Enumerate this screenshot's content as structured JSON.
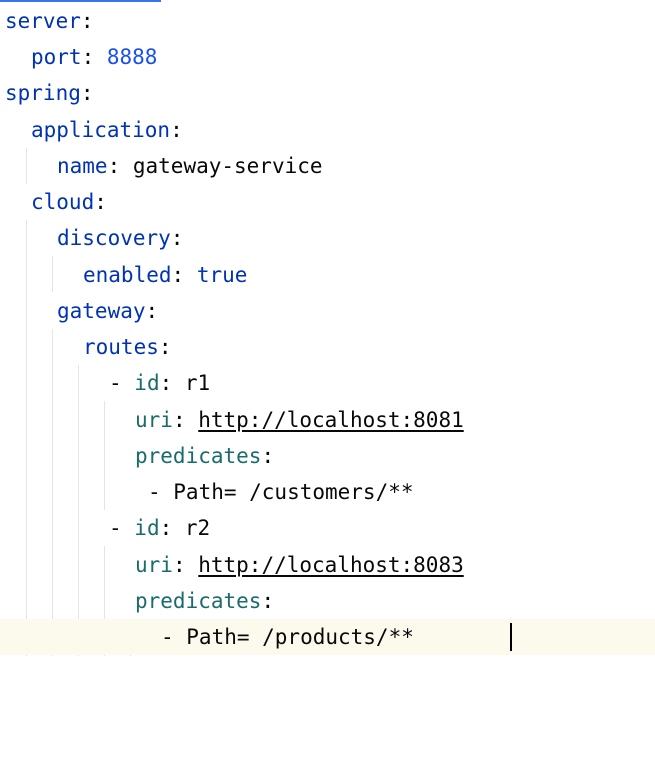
{
  "editor": {
    "lines": [
      {
        "key": "server",
        "sep": ":"
      },
      {
        "key": "port",
        "sep": ": ",
        "value": "8888"
      },
      {
        "key": "spring",
        "sep": ":"
      },
      {
        "key": "application",
        "sep": ":"
      },
      {
        "key": "name",
        "sep": ": ",
        "value": "gateway-service"
      },
      {
        "key": "cloud",
        "sep": ":"
      },
      {
        "key": "discovery",
        "sep": ":"
      },
      {
        "key": "enabled",
        "sep": ": ",
        "value": "true"
      },
      {
        "key": "gateway",
        "sep": ":"
      },
      {
        "key": "routes",
        "sep": ":"
      },
      {
        "dash": "- ",
        "key": "id",
        "sep": ": ",
        "value": "r1"
      },
      {
        "key": "uri",
        "sep": ": ",
        "value": "http://localhost:8081"
      },
      {
        "key": "predicates",
        "sep": ":"
      },
      {
        "value": "- Path= /customers/**"
      },
      {
        "dash": "- ",
        "key": "id",
        "sep": ": ",
        "value": "r2"
      },
      {
        "key": "uri",
        "sep": ": ",
        "value": "http://localhost:8083"
      },
      {
        "key": "predicates",
        "sep": ":"
      },
      {
        "value": "- Path= /products/**"
      }
    ]
  },
  "colors": {
    "key": "#0033b3",
    "nested_key": "#1a6b6b",
    "number": "#1750eb",
    "current_line": "#fcfaed",
    "accent": "#3574f0"
  }
}
